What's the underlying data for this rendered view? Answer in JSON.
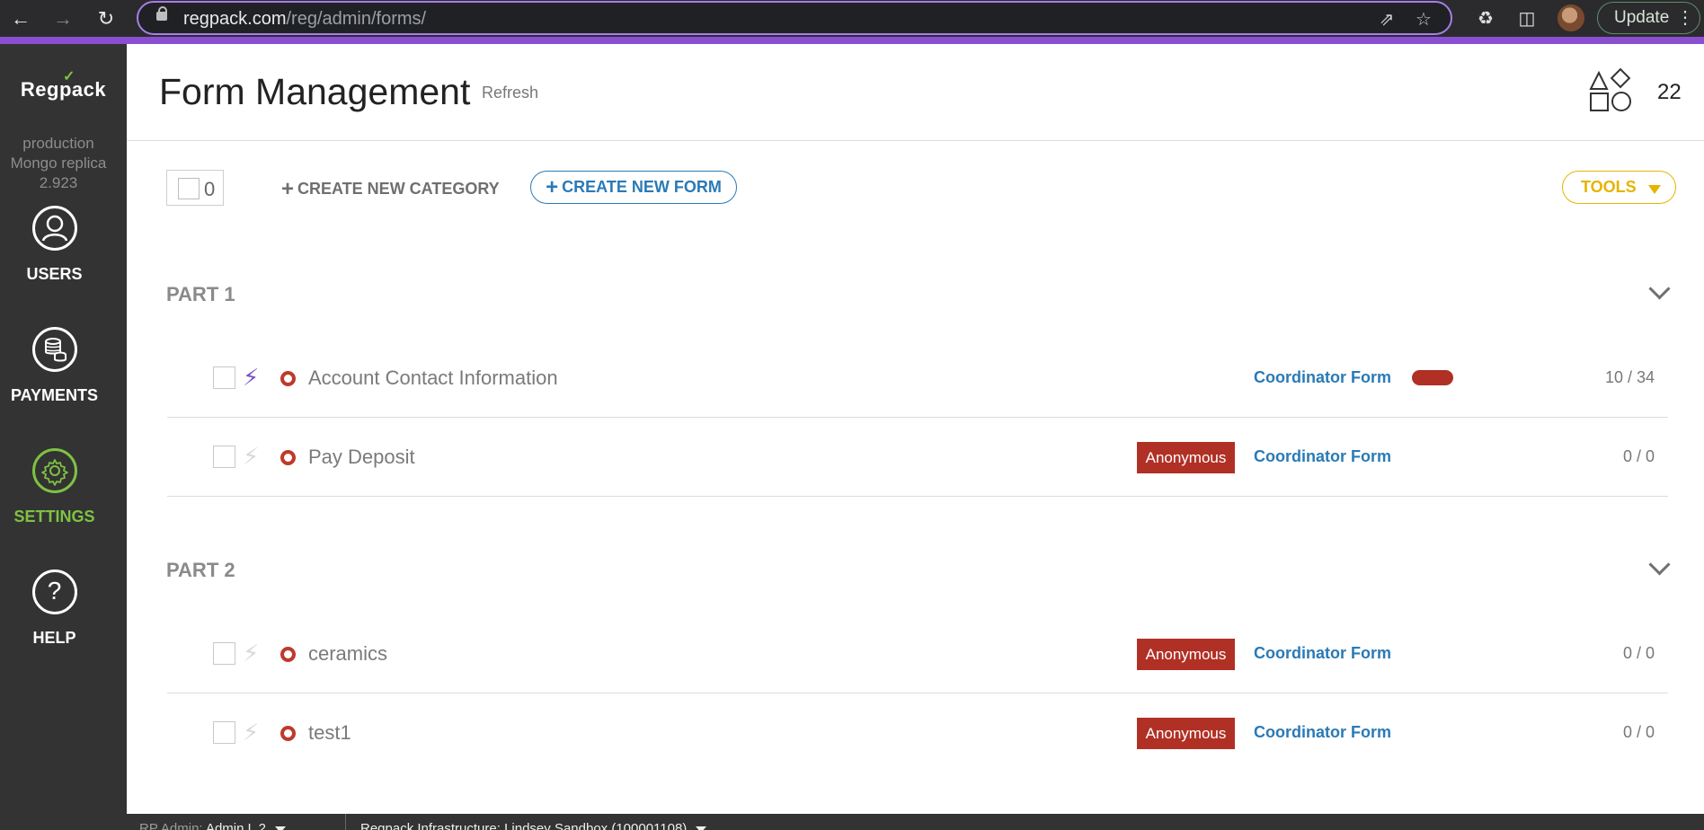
{
  "browser": {
    "url_domain": "regpack.com",
    "url_path": "/reg/admin/forms/",
    "update_label": "Update"
  },
  "sidebar": {
    "logo_text": "Regpack",
    "env_lines": [
      "production",
      "Mongo replica",
      "2.923"
    ],
    "items": [
      {
        "label": "USERS",
        "icon": "user-icon"
      },
      {
        "label": "PAYMENTS",
        "icon": "coins-icon"
      },
      {
        "label": "SETTINGS",
        "icon": "gear-icon",
        "active": true
      },
      {
        "label": "HELP",
        "icon": "question-icon"
      }
    ],
    "active_color": "#7ec242"
  },
  "header": {
    "title": "Form Management",
    "refresh_label": "Refresh",
    "count": "22"
  },
  "toolbar": {
    "selected_count": "0",
    "create_category_label": "CREATE NEW CATEGORY",
    "create_form_label": "CREATE NEW FORM",
    "tools_label": "TOOLS"
  },
  "sections": [
    {
      "title": "PART 1",
      "rows": [
        {
          "name": "Account Contact Information",
          "bolt_active": true,
          "anonymous": "",
          "type": "Coordinator Form",
          "ratio": "10 / 34"
        },
        {
          "name": "Pay Deposit",
          "bolt_active": false,
          "anonymous": "Anonymous",
          "type": "Coordinator Form",
          "ratio": "0 / 0"
        }
      ]
    },
    {
      "title": "PART 2",
      "rows": [
        {
          "name": "ceramics",
          "bolt_active": false,
          "anonymous": "Anonymous",
          "type": "Coordinator Form",
          "ratio": "0 / 0"
        },
        {
          "name": "test1",
          "bolt_active": false,
          "anonymous": "Anonymous",
          "type": "Coordinator Form",
          "ratio": "0 / 0"
        }
      ]
    }
  ],
  "footer": {
    "admin_prefix": "RP Admin:",
    "admin_name": "Admin L 2",
    "org": "Regpack Infrastructure: Lindsey Sandbox (100001108)"
  },
  "colors": {
    "anonymous_badge": "#b03025",
    "link_blue": "#2a7ab6",
    "tools_yellow": "#e6b400",
    "bolt_active": "#7b52c7"
  }
}
